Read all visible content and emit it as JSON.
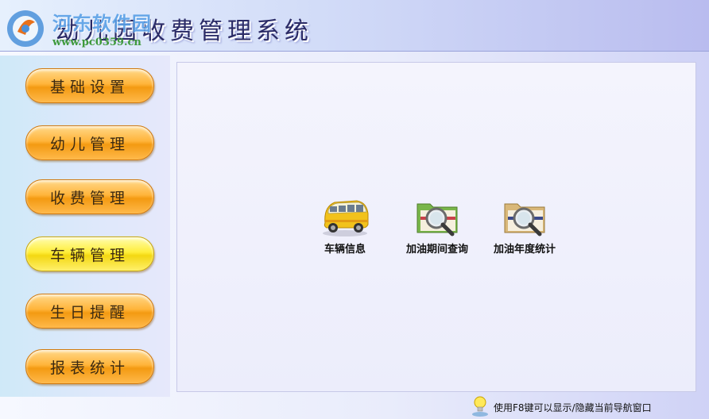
{
  "header": {
    "brand_name": "河东软件园",
    "brand_url": "www.pc0359.cn",
    "title": "幼儿园收费管理系统"
  },
  "nav": {
    "items": [
      {
        "label": "基础设置"
      },
      {
        "label": "幼儿管理"
      },
      {
        "label": "收费管理"
      },
      {
        "label": "车辆管理",
        "active": true
      },
      {
        "label": "生日提醒"
      },
      {
        "label": "报表统计"
      }
    ]
  },
  "functions": [
    {
      "label": "车辆信息",
      "icon": "bus-icon"
    },
    {
      "label": "加油期间查询",
      "icon": "folder-search-icon"
    },
    {
      "label": "加油年度统计",
      "icon": "folder-search-icon"
    }
  ],
  "status": {
    "hint": "使用F8键可以显示/隐藏当前导航窗口",
    "icon": "lightbulb-icon"
  },
  "colors": {
    "button_orange": "#ffb43a",
    "button_active_yellow": "#ffee3a",
    "title_text": "#2b2b66",
    "url_green": "#3f9a3c"
  }
}
